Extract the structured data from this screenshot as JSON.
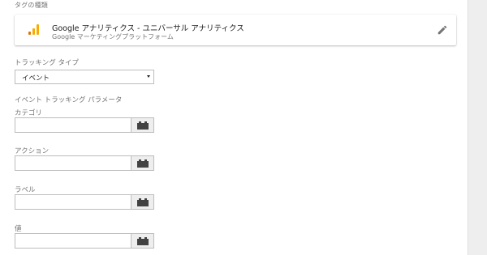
{
  "section": {
    "tag_type_label": "タグの種類"
  },
  "tag": {
    "title": "Google アナリティクス - ユニバーサル アナリティクス",
    "subtitle": "Google マーケティングプラットフォーム",
    "icon": "google-analytics-icon",
    "edit_icon": "pencil-icon",
    "colors": {
      "bar_dark": "#e37400",
      "bar_light": "#f9ab00",
      "edit": "#757575"
    }
  },
  "tracking": {
    "label": "トラッキング タイプ",
    "selected": "イベント"
  },
  "event_params": {
    "header": "イベント トラッキング パラメータ",
    "fields": [
      {
        "label": "カテゴリ",
        "value": ""
      },
      {
        "label": "アクション",
        "value": ""
      },
      {
        "label": "ラベル",
        "value": ""
      },
      {
        "label": "値",
        "value": ""
      }
    ],
    "variable_button_icon": "variable-brick-icon"
  }
}
